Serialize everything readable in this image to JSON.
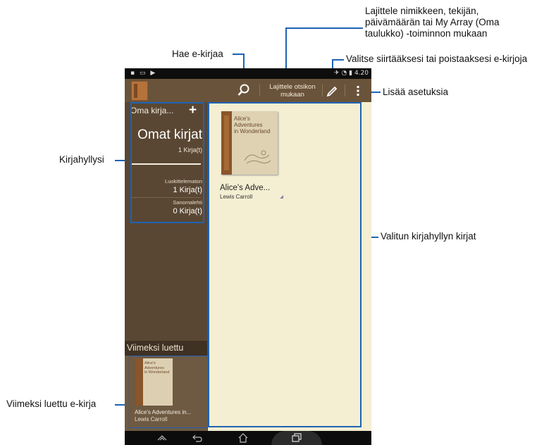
{
  "annotations": {
    "sort": [
      "Lajittele nimikkeen, tekijän,",
      "päivämäärän tai My Array (Oma",
      "taulukko) -toiminnon mukaan"
    ],
    "search": "Hae e-kirjaa",
    "select": "Valitse siirtääksesi tai poistaaksesi e-kirjoja",
    "more": "Lisää asetuksia",
    "bookshelf": "Kirjahyllysi",
    "selected_books": "Valitun kirjahyllyn kirjat",
    "recent": "Viimeksi luettu e-kirja"
  },
  "statusbar": {
    "time": "4.20"
  },
  "actionbar": {
    "sort_label_1": "Lajittele otsikon",
    "sort_label_2": "mukaan",
    "search_icon": "search-icon",
    "edit_icon": "pencil-icon",
    "more_icon": "overflow-menu-icon"
  },
  "sidebar": {
    "title": "Oma kirja...",
    "shelf_name": "Omat kirjat",
    "shelf_count": "1 Kirja(t)",
    "categories": [
      {
        "label": "Luokittelematon",
        "count": "1 Kirja(t)"
      },
      {
        "label": "Sanomalehti",
        "count": "0 Kirja(t)"
      }
    ],
    "recent_header": "Viimeksi luettu",
    "recent_book": {
      "cover_title": [
        "Alice's",
        "Adventures",
        "in Wonderland"
      ],
      "title": "Alice's Adventures in...",
      "author": "Lewis Carroll"
    }
  },
  "main": {
    "books": [
      {
        "cover_title": [
          "Alice's",
          "Adventures",
          "in Wonderland"
        ],
        "title": "Alice's Adve...",
        "author": "Lewis Carroll"
      }
    ]
  },
  "colors": {
    "callout": "#1e63b5",
    "actionbar": "#6a533b",
    "sidebar": "#5a4733",
    "main_bg": "#f4eed2"
  }
}
